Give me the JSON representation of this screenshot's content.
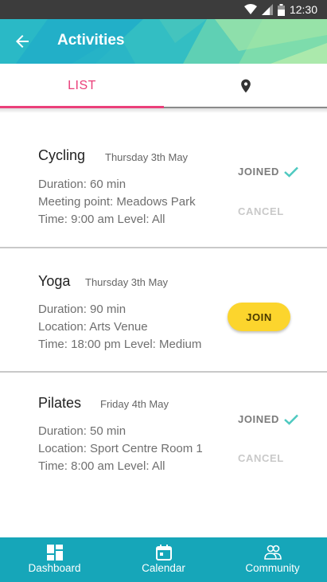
{
  "status_bar": {
    "time": "12:30"
  },
  "app_bar": {
    "title": "Activities"
  },
  "tabs": {
    "list_label": "LIST"
  },
  "activities": [
    {
      "name": "Cycling",
      "date": "Thursday 3th May",
      "details": [
        "Duration: 60 min",
        "Meeting point: Meadows Park",
        "Time: 9:00 am  Level: All"
      ],
      "joined_label": "JOINED",
      "cancel_label": "CANCEL"
    },
    {
      "name": "Yoga",
      "date": "Thursday 3th May",
      "details": [
        "Duration: 90 min",
        "Location: Arts Venue",
        "Time: 18:00 pm  Level: Medium"
      ],
      "join_label": "JOIN"
    },
    {
      "name": "Pilates",
      "date": "Friday 4th May",
      "details": [
        "Duration: 50 min",
        "Location: Sport Centre Room 1",
        "Time: 8:00 am  Level: All"
      ],
      "joined_label": "JOINED",
      "cancel_label": "CANCEL"
    }
  ],
  "bottom_nav": {
    "items": [
      {
        "label": "Dashboard",
        "icon": "dashboard-icon"
      },
      {
        "label": "Calendar",
        "icon": "calendar-icon"
      },
      {
        "label": "Community",
        "icon": "community-icon"
      }
    ]
  },
  "colors": {
    "app_bar": "#1fb3c9",
    "accent_pink": "#ea3f7a",
    "join_yellow": "#fcd52d",
    "check_teal": "#4ec9c0",
    "bottom_nav": "#16a6b9"
  }
}
